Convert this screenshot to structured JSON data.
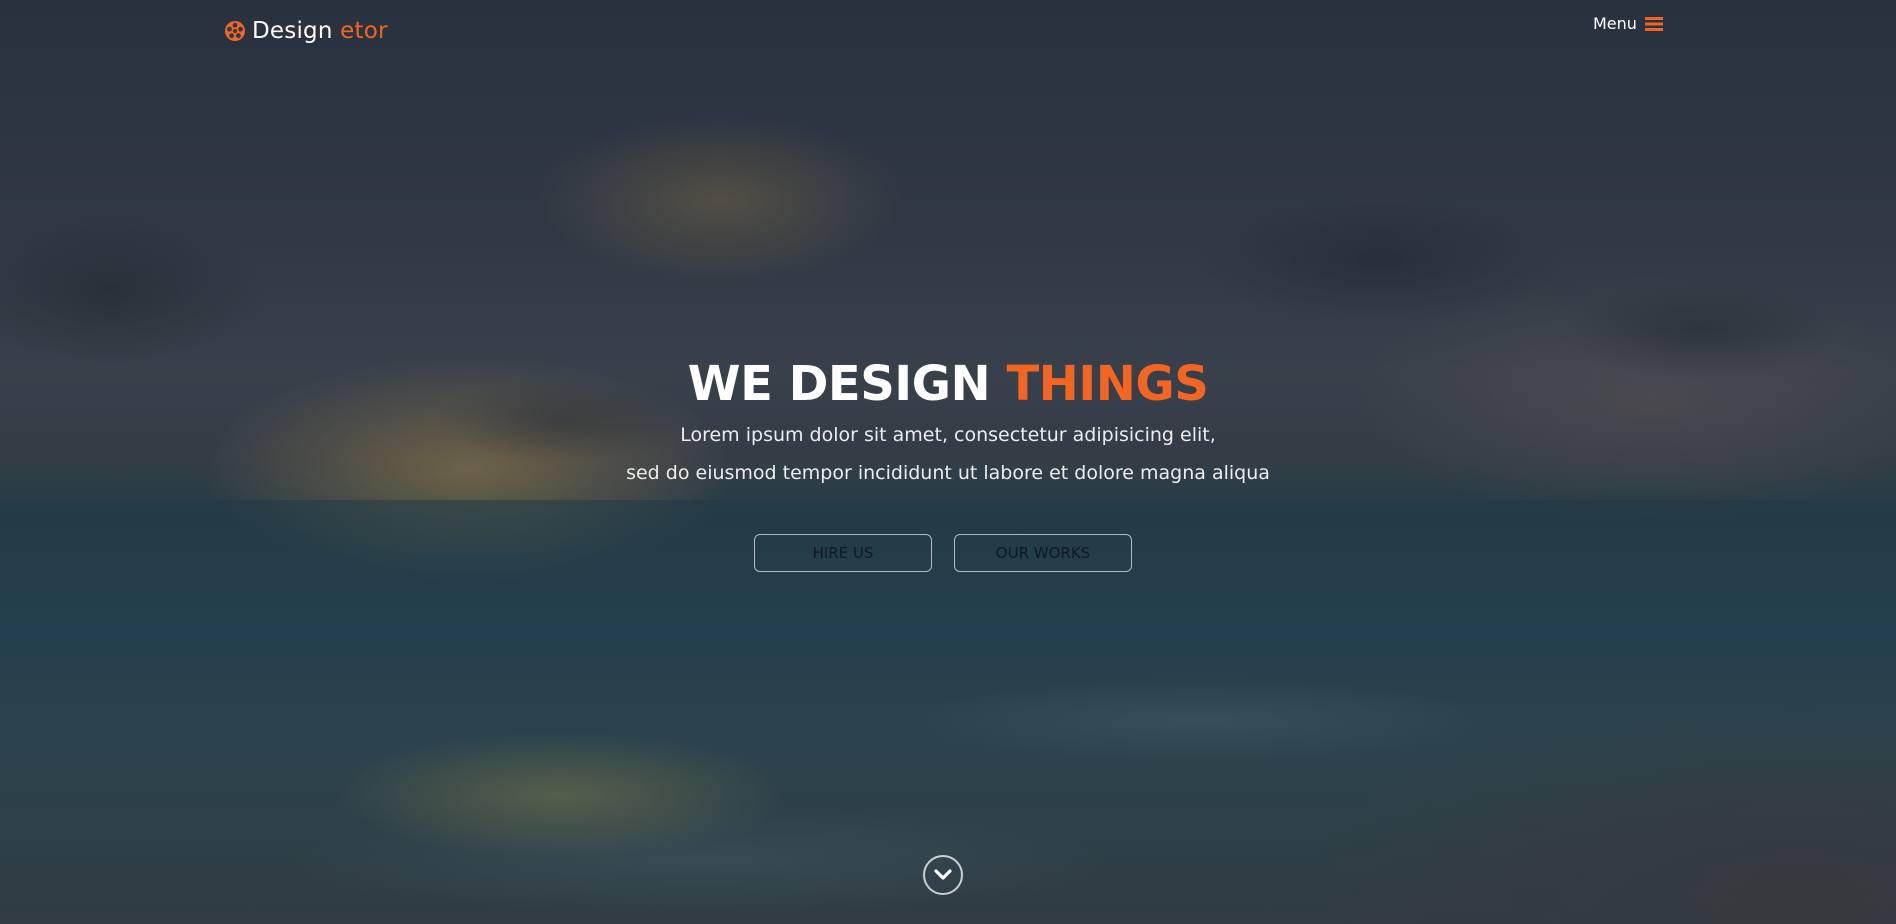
{
  "brand": {
    "name_main": "Design",
    "name_accent": "etor",
    "logo_icon": "film-reel-icon"
  },
  "nav": {
    "menu_label": "Menu",
    "menu_icon": "hamburger-icon"
  },
  "hero": {
    "headline_main": "WE DESIGN",
    "headline_accent": "THINGS",
    "lead_line_1": "Lorem ipsum dolor sit amet, consectetur adipisicing elit,",
    "lead_line_2": "sed do eiusmod tempor incididunt ut labore et dolore magna aliqua",
    "buttons": [
      {
        "label": "HIRE US"
      },
      {
        "label": "OUR WORKS"
      }
    ],
    "scroll_icon": "chevron-down-icon"
  },
  "colors": {
    "accent": "#f26522",
    "text": "#ffffff"
  }
}
